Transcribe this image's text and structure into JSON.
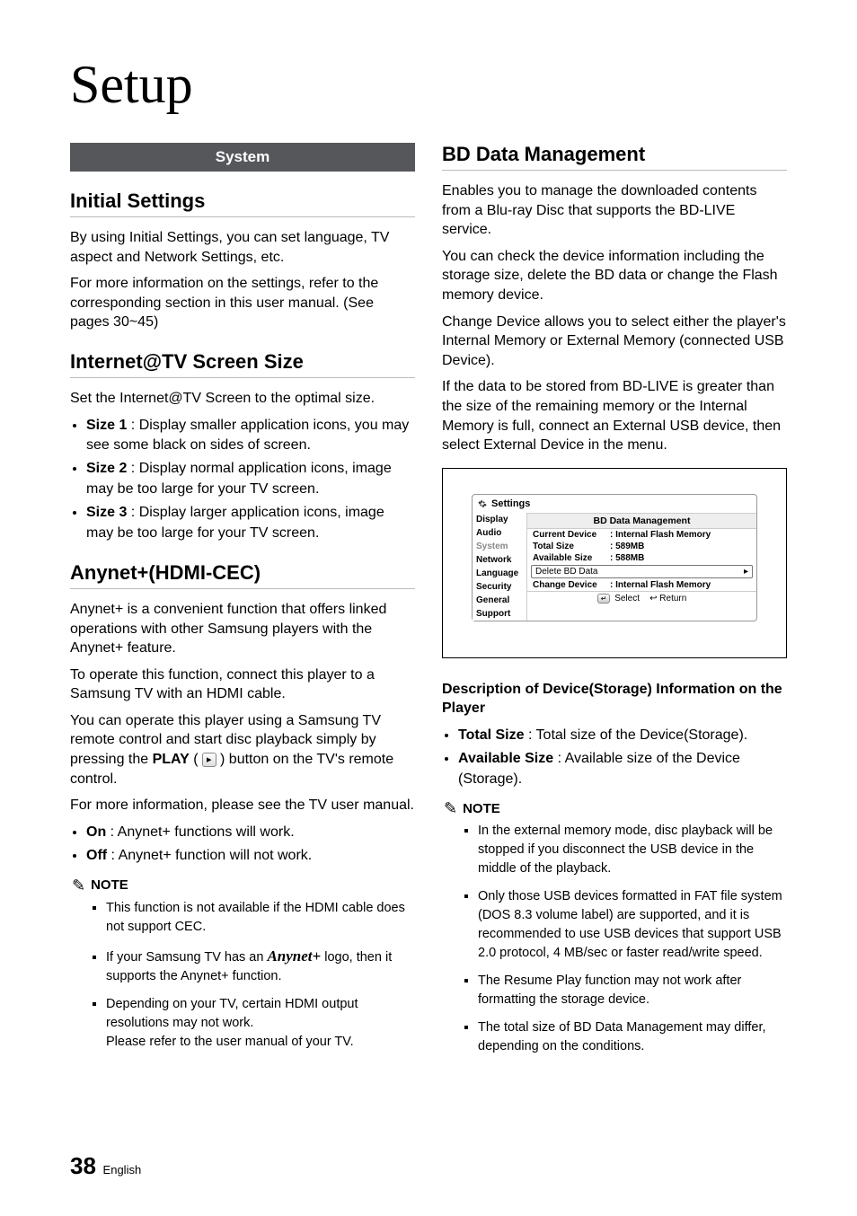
{
  "page": {
    "title": "Setup",
    "section_band": "System",
    "footer_num": "38",
    "footer_lang": "English"
  },
  "left": {
    "h_initial": "Initial Settings",
    "p_initial_1": "By using Initial Settings, you can set language, TV aspect and Network Settings, etc.",
    "p_initial_2": "For more information on the settings, refer to the corresponding section in this user manual. (See pages 30~45)",
    "h_internet": "Internet@TV Screen Size",
    "p_internet": "Set the Internet@TV Screen to the optimal size.",
    "sizes": [
      {
        "bold": "Size 1",
        "text": " : Display smaller application icons, you may see some black on sides of screen."
      },
      {
        "bold": "Size 2",
        "text": " : Display normal application icons, image may be too large for your TV screen."
      },
      {
        "bold": "Size 3",
        "text": " : Display larger application icons, image may be too large for your TV screen."
      }
    ],
    "h_anynet": "Anynet+(HDMI-CEC)",
    "p_anynet_1": "Anynet+ is a convenient function that offers linked operations with other Samsung players with the Anynet+ feature.",
    "p_anynet_2": "To operate this function, connect this player to a Samsung TV with an HDMI cable.",
    "p_anynet_3a": "You can operate this player using a Samsung TV remote control and start disc playback simply by pressing the ",
    "p_anynet_3b_bold": "PLAY",
    "p_anynet_3c": " ) button on the TV's remote control.",
    "p_anynet_4": "For more information, please see the TV user manual.",
    "onoff": [
      {
        "bold": "On",
        "text": " : Anynet+ functions will work."
      },
      {
        "bold": "Off",
        "text": " : Anynet+ function will not work."
      }
    ],
    "note_label": "NOTE",
    "notes": {
      "n1": "This function is not available if the HDMI cable does not support CEC.",
      "n2a": "If your Samsung TV has an ",
      "n2_logo": "Anynet+",
      "n2b": " logo, then it supports the Anynet+ function.",
      "n3": "Depending on your TV, certain HDMI output resolutions may not work.\nPlease refer to the user manual of your TV."
    }
  },
  "right": {
    "h_bd": "BD Data Management",
    "p_bd_1": "Enables you to manage the downloaded contents from a Blu-ray Disc that supports the BD-LIVE service.",
    "p_bd_2": "You can check the device information including the storage size, delete the BD data or change the Flash memory device.",
    "p_bd_3": "Change Device allows you to select either the player's Internal Memory or External Memory (connected USB Device).",
    "p_bd_4": "If the data to be stored from BD-LIVE is greater than the size of the remaining memory or the Internal Memory is full, connect an External USB device, then select External Device in the menu.",
    "shot": {
      "header": "Settings",
      "side": [
        "Display",
        "Audio",
        "System",
        "Network",
        "Language",
        "Security",
        "General",
        "Support"
      ],
      "active_index": 2,
      "title": "BD Data Management",
      "rows": {
        "r1k": "Current Device",
        "r1v": ": Internal Flash Memory",
        "r2k": "Total Size",
        "r2v": ": 589MB",
        "r3k": "Available Size",
        "r3v": ": 588MB",
        "r4k": "Delete BD Data",
        "r4arrow": "▸",
        "r5k": "Change Device",
        "r5v": ": Internal Flash Memory"
      },
      "foot_select": "Select",
      "foot_return": "Return",
      "foot_enter_glyph": "↵",
      "foot_return_glyph": "↩"
    },
    "desc_header": "Description of Device(Storage) Information on the Player",
    "desc_bullets": [
      {
        "bold": "Total Size",
        "text": " : Total size of the Device(Storage)."
      },
      {
        "bold": "Available Size",
        "text": " : Available size of the Device (Storage)."
      }
    ],
    "note_label": "NOTE",
    "notes": [
      "In the external memory mode, disc playback will be stopped if you disconnect the USB device in the middle of the playback.",
      "Only those USB devices formatted in FAT file system (DOS 8.3 volume label) are supported, and it is recommended to use USB devices that support USB 2.0 protocol, 4 MB/sec or faster read/write speed.",
      "The Resume Play function may not work after formatting the storage device.",
      "The total size of BD Data Management may differ, depending on the conditions."
    ]
  }
}
